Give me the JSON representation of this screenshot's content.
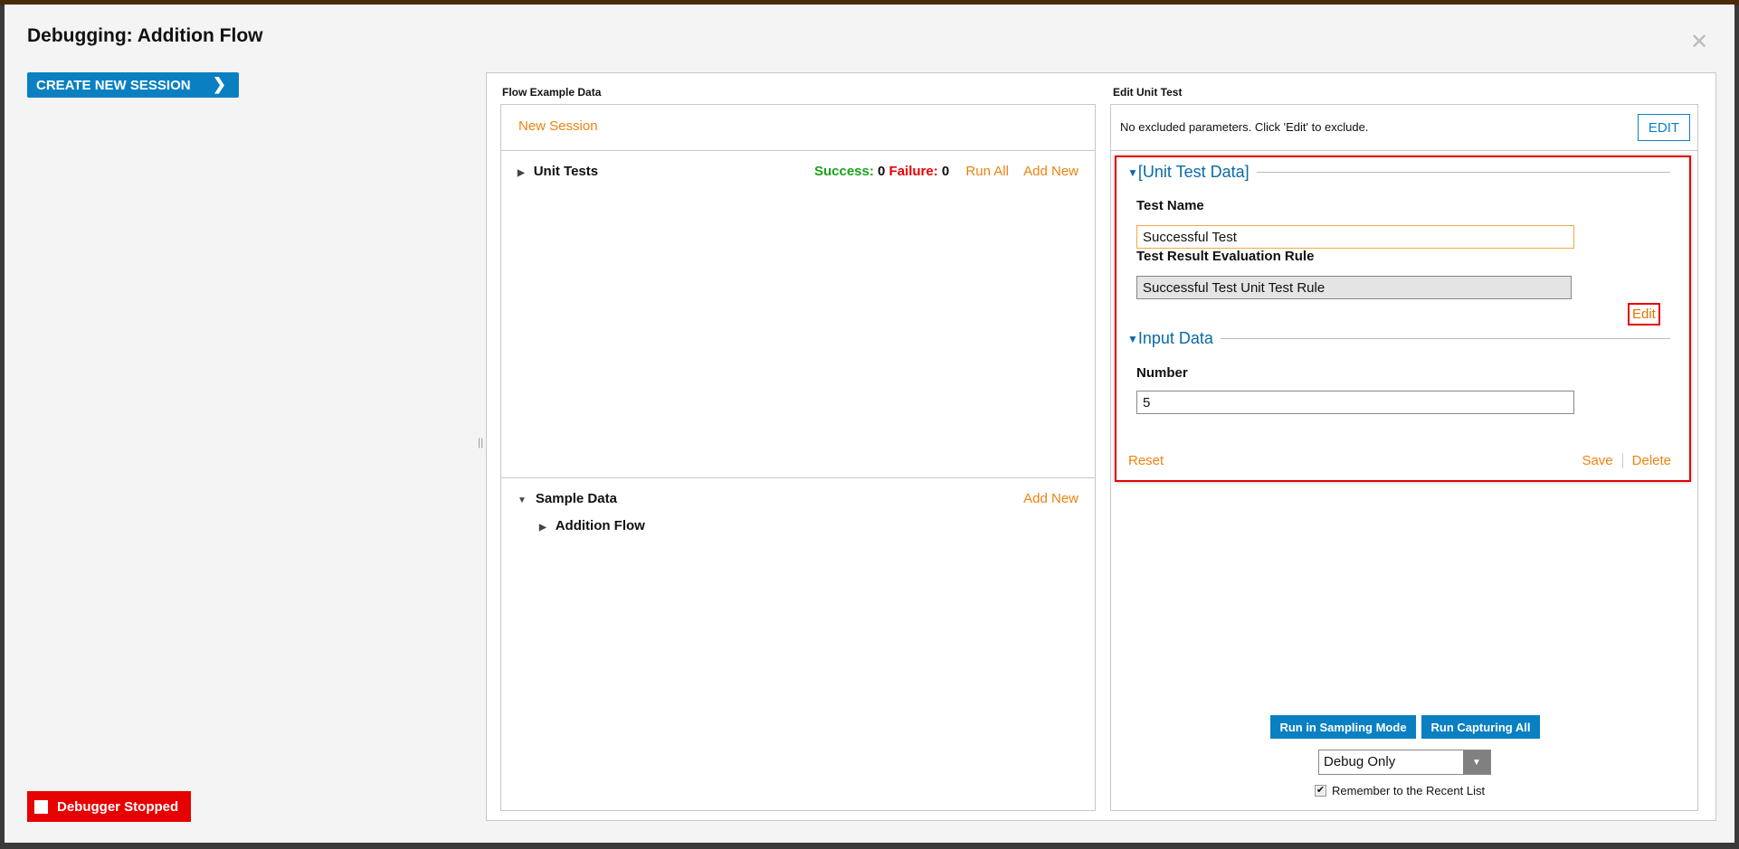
{
  "title": "Debugging: Addition Flow",
  "create_session": "CREATE NEW SESSION",
  "debugger_status": "Debugger Stopped",
  "left": {
    "label": "Flow Example Data",
    "new_session": "New Session",
    "unit_tests": {
      "label": "Unit Tests",
      "success_label": "Success:",
      "success_count": "0",
      "failure_label": "Failure:",
      "failure_count": "0",
      "run_all": "Run All",
      "add_new": "Add New"
    },
    "sample_data": {
      "label": "Sample Data",
      "add_new": "Add New",
      "items": [
        "Addition Flow"
      ]
    }
  },
  "right": {
    "label": "Edit Unit Test",
    "excluded_text": "No excluded parameters. Click 'Edit' to exclude.",
    "edit_button": "EDIT",
    "section1": "[Unit Test Data]",
    "test_name_label": "Test Name",
    "test_name_value": "Successful Test",
    "rule_label": "Test Result Evaluation Rule",
    "rule_value": "Successful Test Unit Test Rule",
    "rule_edit": "Edit",
    "section2": "Input Data",
    "number_label": "Number",
    "number_value": "5",
    "reset": "Reset",
    "save": "Save",
    "delete": "Delete",
    "run_sampling": "Run in Sampling Mode",
    "run_capturing": "Run Capturing All",
    "mode_select": "Debug Only",
    "remember": "Remember to the Recent List",
    "remember_checked": true
  },
  "colors": {
    "accent": "#0a80c2",
    "link": "#f0820f",
    "success": "#1aa21a",
    "failure": "#e60000",
    "highlight": "#e60000"
  }
}
